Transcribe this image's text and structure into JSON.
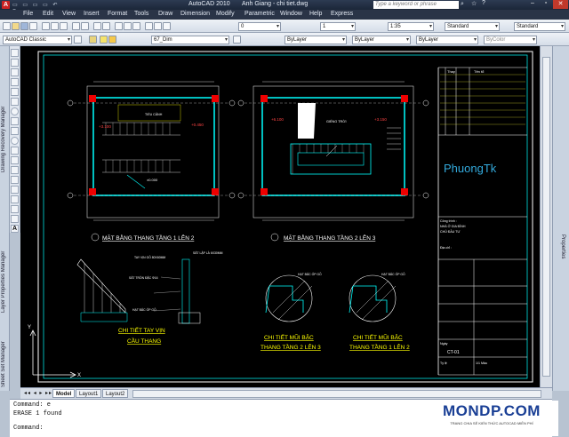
{
  "title_bar": {
    "app": "AutoCAD 2010",
    "document": "Anh Giang - chi tiet.dwg",
    "search_placeholder": "Type a keyword or phrase"
  },
  "menu": [
    "File",
    "Edit",
    "View",
    "Insert",
    "Format",
    "Tools",
    "Draw",
    "Dimension",
    "Modify",
    "Parametric",
    "Window",
    "Help",
    "Express"
  ],
  "toolbar_row1": {
    "layer": "0",
    "scale": "1",
    "annoscale": "1:35",
    "text_style": "Standard",
    "dim_style": "Standard"
  },
  "toolbar_row2": {
    "workspace": "AutoCAD Classic",
    "layer_current": "67_Dim",
    "color": "ByLayer",
    "linetype": "ByLayer",
    "lineweight": "ByLayer",
    "plotstyle": "ByColor"
  },
  "left_palettes": [
    "Drawing Recovery Manager",
    "Layer Properties Manager",
    "Sheet Set Manager"
  ],
  "right_palettes": [
    "Properties"
  ],
  "drawing": {
    "plan1_title": "MẶT BẰNG THANG TẦNG 1 LÊN 2",
    "plan2_title": "MẶT BẰNG THANG TẦNG 2 LÊN 3",
    "detail1_title": "CHI TIẾT TAY VỊN",
    "detail1_title2": "CẦU THANG",
    "detail2_title": "CHI TIẾT MŨI BẬC",
    "detail2_title2": "THANG TẦNG 2 LÊN 3",
    "detail3_title": "CHI TIẾT MŨI BẬC",
    "detail3_title2": "THANG TẦNG 1 LÊN 2",
    "label_tieu_canh": "TIỂU CẢNH",
    "label_gieng_troi": "GIẾNG TRỜI",
    "elev_a": "+3.100",
    "elev_b": "+0.450",
    "elev_c": "±0.000",
    "elev_d": "+6.100",
    "elev_e": "+3.150",
    "handrail_note1": "TAY VỊN GỖ 80X60MM",
    "handrail_note2": "SẮT TRÒN ĐẶC Φ16",
    "handrail_note3": "HẠT BẮC ỐP GỖ",
    "handrail_note4": "SẮT LẬP LÀ 6X30MM",
    "step_note": "HẠT BẮC ỐP GỖ",
    "brand": "PhuongTk",
    "tb_header1": "Thay",
    "tb_header2": "Tên tổ",
    "tb_project1": "Công trình :",
    "tb_project2": "NHÀ Ở GIA ĐÌNH",
    "tb_owner": "CHỦ ĐẦU TƯ",
    "tb_address": "Địa chỉ :",
    "tb_sheet": "CT-01",
    "tb_date": "Ngày",
    "tb_scale": "Tỷ lệ",
    "tb_scale_val": "1/1 Mầu"
  },
  "layout_tabs": [
    "Model",
    "Layout1",
    "Layout2"
  ],
  "command_lines": [
    "Command: e",
    "ERASE 1 found",
    "Command:"
  ],
  "watermark": {
    "main": "MONDP.COM",
    "sub": "TRANG CHIA SẺ KIẾN THỨC AUTOCAD MIỄN PHÍ"
  }
}
